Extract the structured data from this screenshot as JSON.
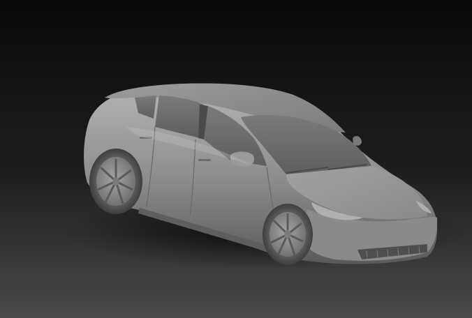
{
  "scene": {
    "subject_icon": "car-render-icon",
    "background_colors": {
      "top": "#0a0a0a",
      "bottom": "#4a4a4a"
    },
    "body_color": "#8e8e8e",
    "glass_color": "#6a6a6a",
    "wheel_color": "#5a5a5a"
  }
}
